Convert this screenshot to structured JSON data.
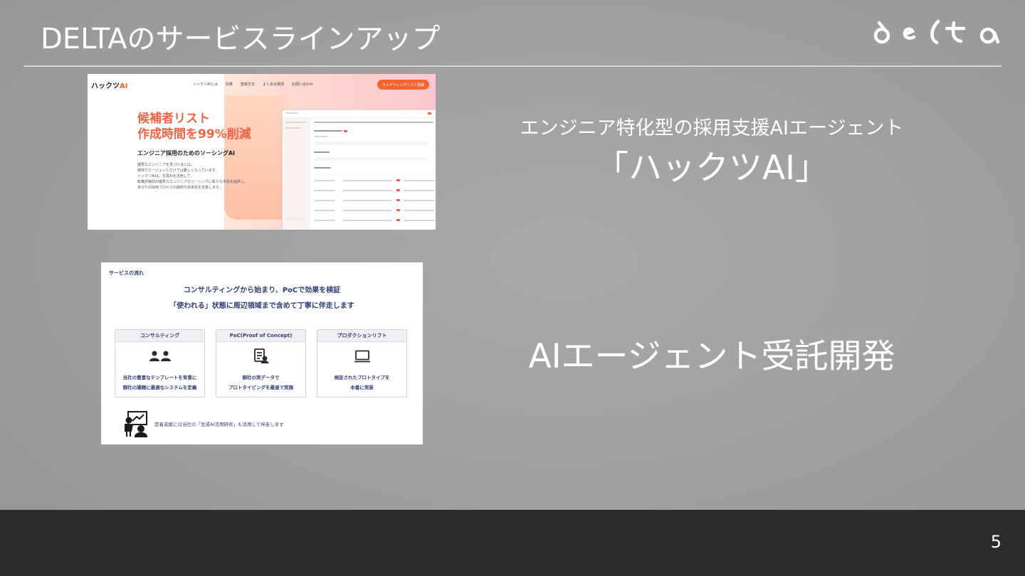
{
  "slide": {
    "title": "DELTAのサービスラインアップ",
    "page_number": "5",
    "logo_text": "delta"
  },
  "products": [
    {
      "tagline": "エンジニア特化型の採用支援AIエージェント",
      "name": "「ハックツAI」"
    },
    {
      "name": "AIエージェント受託開発"
    }
  ],
  "hackutsu_screenshot": {
    "brand": "ハックツ",
    "brand_accent": "AI",
    "nav": [
      "ハックツAIとは",
      "効果",
      "登録方法",
      "よくある質問",
      "お問い合わせ"
    ],
    "cta": "ウェイティングリスト登録",
    "headline_1": "候補者リスト",
    "headline_2": "作成時間を99%削減",
    "subheadline": "エンジニア採用のためのソーシングAI",
    "body": [
      "優秀なエンジニアを見つけるには、",
      "媒体やエージェントだけでは難しくなっています。",
      "ハックツAIは、生成AIを活用して、",
      "転職評価前の優秀なエンジニアのソーシングに新たな手段を提供し、",
      "あなたの採用プロセスの劇的な効率化を支援します。"
    ]
  },
  "service_flow": {
    "label": "サービスの流れ",
    "heading_1": "コンサルティングから始まり、PoCで効果を検証",
    "heading_2": "「使われる」状態に周辺領域まで含めて丁寧に伴走します",
    "cards": [
      {
        "title": "コンサルティング",
        "icon": "people-icon",
        "line1": "当社の豊富なテンプレートを背景に",
        "line2": "御社の課題に最適なシステムを定義"
      },
      {
        "title": "PoC(Proof of Concept)",
        "icon": "document-user-icon",
        "line1": "御社の実データで",
        "line2": "プロトタイピングを最速で実施"
      },
      {
        "title": "プロダクションリフト",
        "icon": "laptop-icon",
        "line1": "検証されたプロトタイプを",
        "line2": "本番に実装"
      }
    ],
    "footer_note": "定着支援には当社の「生成AI活用研修」も活用して伴走します",
    "footer_icon": "training-presentation-icon"
  },
  "colors": {
    "background": "#a1a1a1",
    "footer_bar": "#2b2b2b",
    "hackutsu_orange": "#f06244",
    "flow_navy": "#2f3e72"
  }
}
